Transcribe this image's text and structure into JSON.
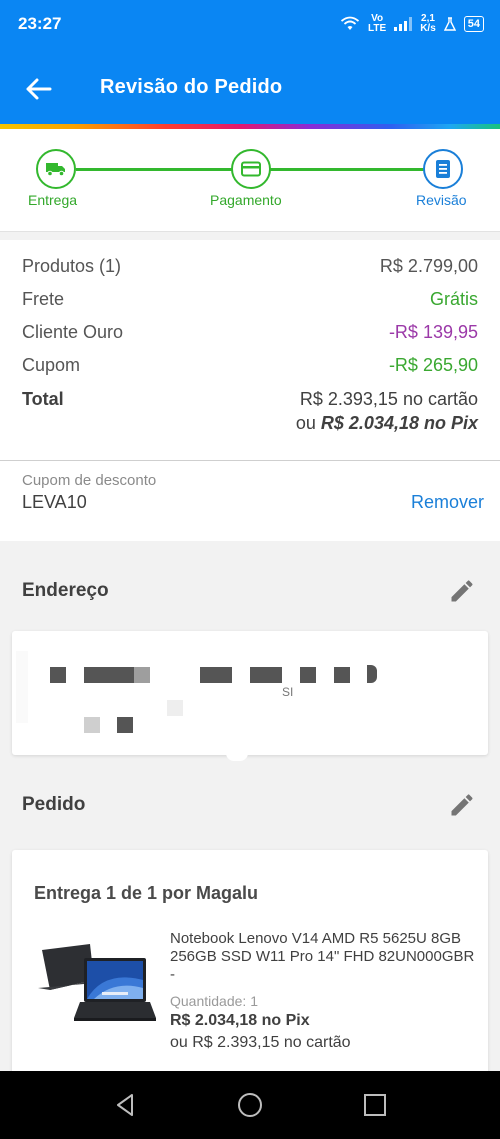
{
  "status_bar": {
    "time": "23:27",
    "network_top": "Vo",
    "network_bottom": "LTE",
    "speed_top": "2,1",
    "speed_bottom": "K/s",
    "battery": "54"
  },
  "header": {
    "title": "Revisão do Pedido",
    "back_icon": "arrow-left-icon",
    "bg_color": "#0a86f3"
  },
  "stepper": {
    "steps": [
      {
        "label": "Entrega",
        "icon": "truck-icon",
        "state": "done",
        "color": "#33b82e"
      },
      {
        "label": "Pagamento",
        "icon": "card-icon",
        "state": "done",
        "color": "#33b82e"
      },
      {
        "label": "Revisão",
        "icon": "document-icon",
        "state": "active",
        "color": "#1a7fd8"
      }
    ]
  },
  "summary": {
    "products_label": "Produtos (1)",
    "products_value": "R$ 2.799,00",
    "shipping_label": "Frete",
    "shipping_value": "Grátis",
    "gold_label": "Cliente Ouro",
    "gold_value": "-R$ 139,95",
    "coupon_label": "Cupom",
    "coupon_value": "-R$ 265,90",
    "total_label": "Total",
    "total_card": "R$ 2.393,15 no cartão",
    "total_pix_prefix": "ou ",
    "total_pix": "R$ 2.034,18 no Pix"
  },
  "coupon": {
    "label": "Cupom de desconto",
    "code": "LEVA10",
    "remove_label": "Remover"
  },
  "address": {
    "title": "Endereço",
    "partial_text": "SI"
  },
  "order": {
    "title": "Pedido",
    "shipment_title": "Entrega 1 de 1 por Magalu",
    "product_name": "Notebook Lenovo V14 AMD R5 5625U 8GB 256GB SSD W11 Pro 14\" FHD 82UN000GBR -",
    "quantity_label": "Quantidade:",
    "quantity_value": "1",
    "price_pix": "R$ 2.034,18 no Pix",
    "price_card": "ou R$ 2.393,15 no cartão"
  },
  "nav": {
    "back_icon": "triangle-back-icon",
    "home_icon": "circle-home-icon",
    "recents_icon": "square-recents-icon"
  }
}
